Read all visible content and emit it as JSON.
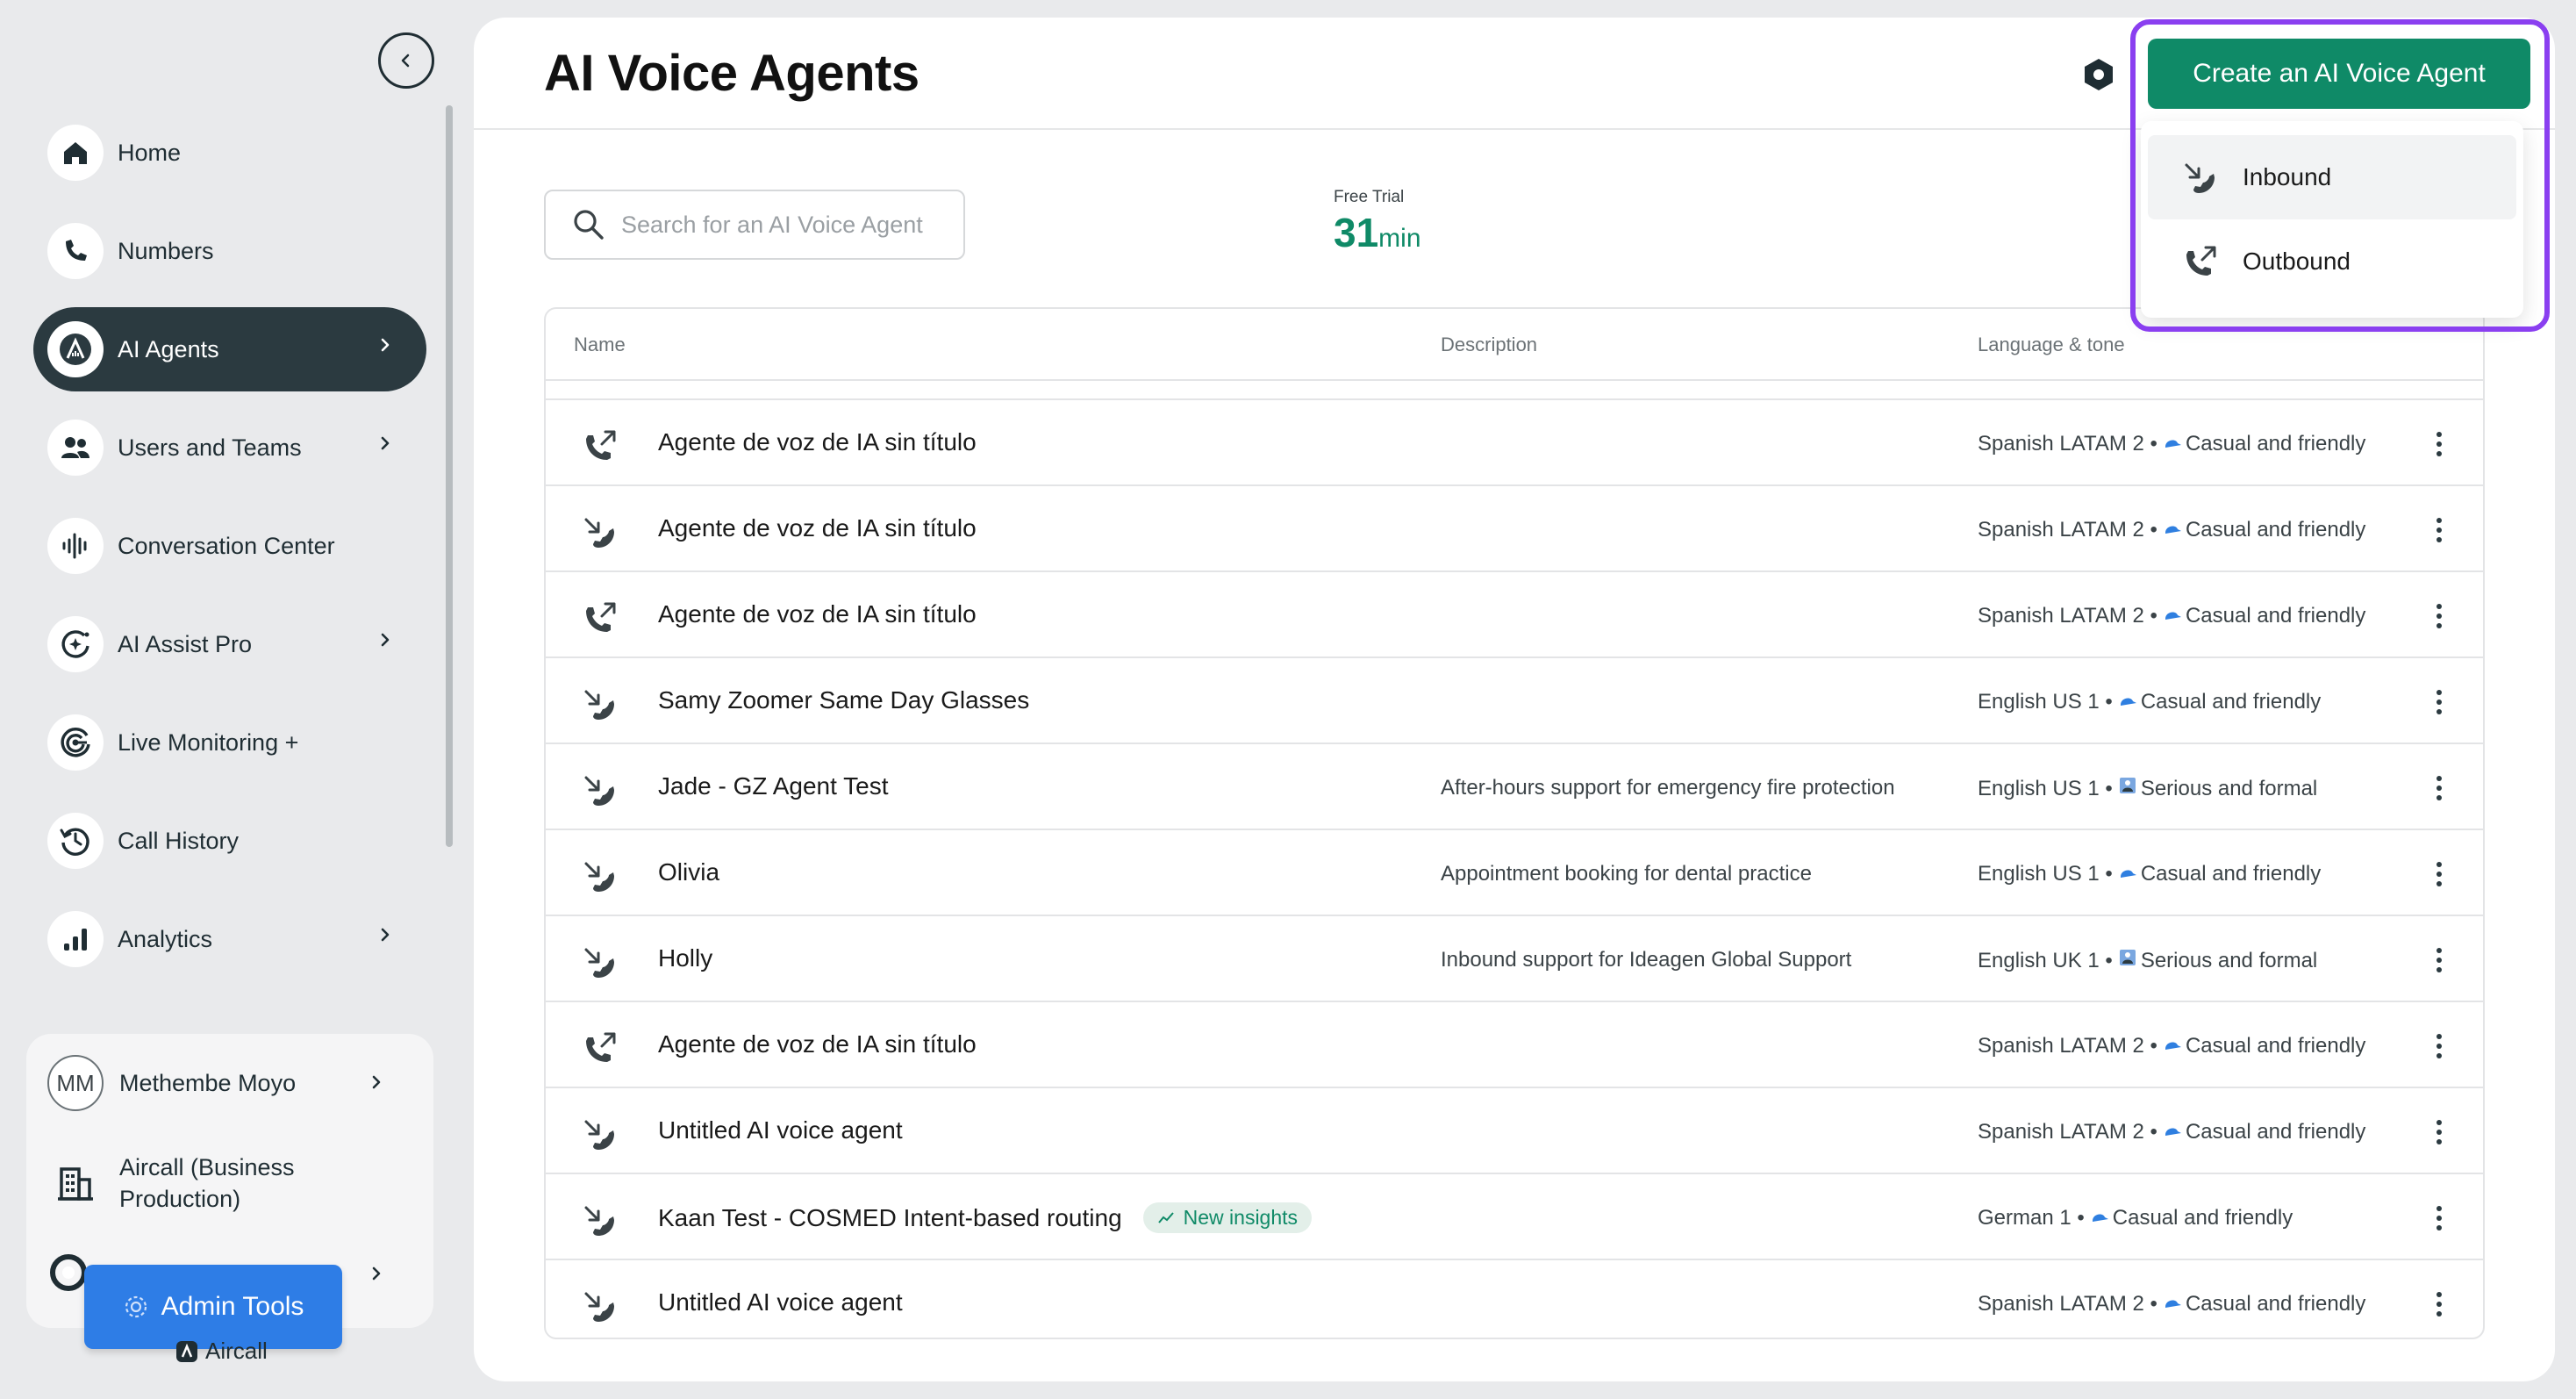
{
  "sidebar": {
    "nav": [
      {
        "label": "Home",
        "icon": "home-icon",
        "chevron": false
      },
      {
        "label": "Numbers",
        "icon": "phone-icon",
        "chevron": false
      },
      {
        "label": "AI Agents",
        "icon": "ai-agent-icon",
        "chevron": true,
        "active": true
      },
      {
        "label": "Users and Teams",
        "icon": "users-icon",
        "chevron": true
      },
      {
        "label": "Conversation Center",
        "icon": "waveform-icon",
        "chevron": false
      },
      {
        "label": "AI Assist Pro",
        "icon": "ai-assist-icon",
        "chevron": true
      },
      {
        "label": "Live Monitoring +",
        "icon": "live-monitoring-icon",
        "chevron": false
      },
      {
        "label": "Call History",
        "icon": "history-icon",
        "chevron": false
      },
      {
        "label": "Analytics",
        "icon": "analytics-icon",
        "chevron": true
      }
    ],
    "user": {
      "initials": "MM",
      "name": "Methembe Moyo"
    },
    "company": {
      "line1": "Aircall (Business",
      "line2": "Production)"
    },
    "admin_button": "Admin Tools",
    "footer_logo": "Aircall"
  },
  "header": {
    "title": "AI Voice Agents",
    "create_button": "Create an AI Voice Agent"
  },
  "dropdown": {
    "items": [
      {
        "label": "Inbound",
        "icon": "inbound-call-icon"
      },
      {
        "label": "Outbound",
        "icon": "outbound-call-icon"
      }
    ]
  },
  "search": {
    "placeholder": "Search for an AI Voice Agent"
  },
  "trial": {
    "label": "Free Trial",
    "value": "31",
    "unit": "min"
  },
  "table": {
    "columns": [
      "Name",
      "Description",
      "Language & tone"
    ],
    "rows": [
      {
        "direction": "outbound",
        "name": "Agente de voz de IA sin título",
        "description": "",
        "language": "Spanish LATAM 2 •",
        "tone_icon": "cap",
        "tone": "Casual and friendly"
      },
      {
        "direction": "inbound",
        "name": "Agente de voz de IA sin título",
        "description": "",
        "language": "Spanish LATAM 2 •",
        "tone_icon": "cap",
        "tone": "Casual and friendly"
      },
      {
        "direction": "outbound",
        "name": "Agente de voz de IA sin título",
        "description": "",
        "language": "Spanish LATAM 2 •",
        "tone_icon": "cap",
        "tone": "Casual and friendly"
      },
      {
        "direction": "inbound",
        "name": "Samy Zoomer Same Day Glasses",
        "description": "",
        "language": "English US 1 •",
        "tone_icon": "cap",
        "tone": "Casual and friendly"
      },
      {
        "direction": "inbound",
        "name": "Jade - GZ Agent Test",
        "description": "After-hours support for emergency fire protection",
        "language": "English US 1 •",
        "tone_icon": "suit",
        "tone": "Serious and formal"
      },
      {
        "direction": "inbound",
        "name": "Olivia",
        "description": "Appointment booking for dental practice",
        "language": "English US 1 •",
        "tone_icon": "cap",
        "tone": "Casual and friendly"
      },
      {
        "direction": "inbound",
        "name": "Holly",
        "description": "Inbound support for Ideagen Global Support",
        "language": "English UK 1 •",
        "tone_icon": "suit",
        "tone": "Serious and formal"
      },
      {
        "direction": "outbound",
        "name": "Agente de voz de IA sin título",
        "description": "",
        "language": "Spanish LATAM 2 •",
        "tone_icon": "cap",
        "tone": "Casual and friendly"
      },
      {
        "direction": "inbound",
        "name": "Untitled AI voice agent",
        "description": "",
        "language": "Spanish LATAM 2 •",
        "tone_icon": "cap",
        "tone": "Casual and friendly"
      },
      {
        "direction": "inbound",
        "name": "Kaan Test - COSMED Intent-based routing",
        "badge": "New insights",
        "description": "",
        "language": "German 1 •",
        "tone_icon": "cap",
        "tone": "Casual and friendly"
      },
      {
        "direction": "inbound",
        "name": "Untitled AI voice agent",
        "description": "",
        "language": "Spanish LATAM 2 •",
        "tone_icon": "cap",
        "tone": "Casual and friendly"
      }
    ]
  },
  "colors": {
    "brand_green": "#0f8a67",
    "sidebar_active": "#2b3a40",
    "admin_blue": "#2e7de6",
    "highlight_purple": "#8a3ff0"
  }
}
